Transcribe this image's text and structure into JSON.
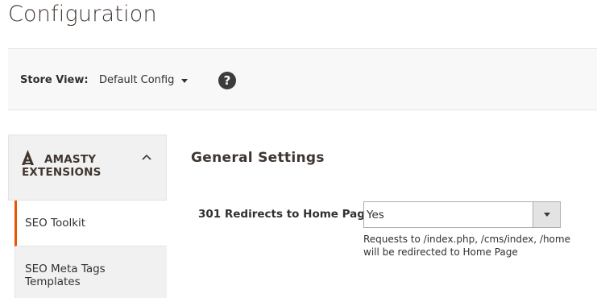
{
  "page": {
    "title": "Configuration"
  },
  "store_bar": {
    "label": "Store View:",
    "selected": "Default Config",
    "help_glyph": "?"
  },
  "sidebar": {
    "group_label": "AMASTY EXTENSIONS",
    "group_icon": "amasty-logo-icon",
    "items": [
      {
        "label": "SEO Toolkit",
        "active": true
      },
      {
        "label": "SEO Meta Tags Templates",
        "active": false
      }
    ]
  },
  "main": {
    "section_title": "General Settings",
    "fields": [
      {
        "label": "301 Redirects to Home Page",
        "value": "Yes",
        "note": "Requests to /index.php, /cms/index, /home will be redirected to Home Page"
      }
    ]
  },
  "colors": {
    "accent": "#eb5202",
    "text": "#303030",
    "heading": "#41362f"
  }
}
